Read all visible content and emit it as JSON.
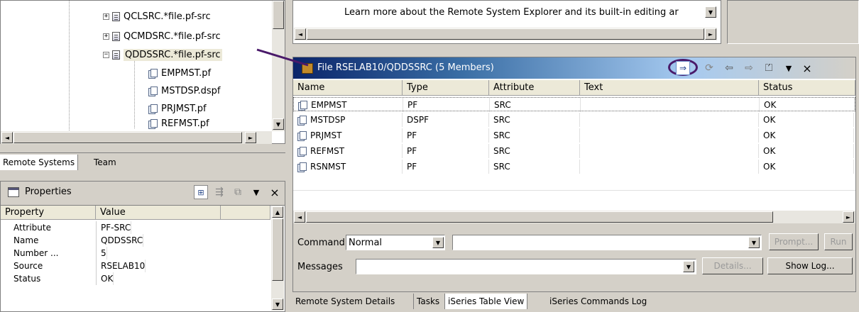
{
  "tree": {
    "items": [
      {
        "label": "QCLSRC.*file.pf-src"
      },
      {
        "label": "QCMDSRC.*file.pf-src"
      },
      {
        "label": "QDDSSRC.*file.pf-src"
      },
      {
        "label": "EMPMST.pf"
      },
      {
        "label": "MSTDSP.dspf"
      },
      {
        "label": "PRJMST.pf"
      },
      {
        "label": "REFMST.pf"
      }
    ],
    "expand_plus": "+",
    "expand_minus": "−"
  },
  "left_tabs": {
    "remote_systems": "Remote Systems",
    "team": "Team"
  },
  "properties": {
    "title": "Properties",
    "col_property": "Property",
    "col_value": "Value",
    "rows": [
      {
        "property": "Attribute",
        "value": "PF-SRC"
      },
      {
        "property": "Name",
        "value": "QDDSSRC"
      },
      {
        "property": "Number ...",
        "value": "5"
      },
      {
        "property": "Source",
        "value": "RSELAB10"
      },
      {
        "property": "Status",
        "value": "OK"
      }
    ]
  },
  "top_panel": {
    "text": "Learn more about the Remote System Explorer and its built-in editing ar"
  },
  "table_view": {
    "title": "File RSELAB10/QDDSSRC (5 Members)",
    "columns": [
      "Name",
      "Type",
      "Attribute",
      "Text",
      "Status"
    ],
    "rows": [
      {
        "name": "EMPMST",
        "type": "PF",
        "attribute": "SRC",
        "text": "",
        "status": "OK"
      },
      {
        "name": "MSTDSP",
        "type": "DSPF",
        "attribute": "SRC",
        "text": "",
        "status": "OK"
      },
      {
        "name": "PRJMST",
        "type": "PF",
        "attribute": "SRC",
        "text": "",
        "status": "OK"
      },
      {
        "name": "REFMST",
        "type": "PF",
        "attribute": "SRC",
        "text": "",
        "status": "OK"
      },
      {
        "name": "RSNMST",
        "type": "PF",
        "attribute": "SRC",
        "text": "",
        "status": "OK"
      }
    ]
  },
  "command_bar": {
    "command_label": "Command",
    "mode_value": "Normal",
    "command_value": "",
    "prompt_label": "Prompt...",
    "run_label": "Run",
    "messages_label": "Messages",
    "messages_value": "",
    "details_label": "Details...",
    "show_log_label": "Show Log..."
  },
  "bottom_tabs": {
    "tab1": "Remote System Details",
    "tab2": "Tasks",
    "tab3": "iSeries Table View",
    "tab4": "iSeries Commands Log"
  },
  "glyphs": {
    "arrow_left": "◄",
    "arrow_right": "►",
    "arrow_up": "▲",
    "arrow_down": "▼",
    "close": "×",
    "menu_down": "▼",
    "nav_back": "⇦",
    "nav_forward": "⇨",
    "up_folder": "⏍",
    "link_action": "⇒",
    "refresh": "⟳"
  },
  "colors": {
    "title_bar_start": "#0a246a",
    "title_bar_end": "#a6caf0",
    "annotation": "#4a1a6a"
  }
}
